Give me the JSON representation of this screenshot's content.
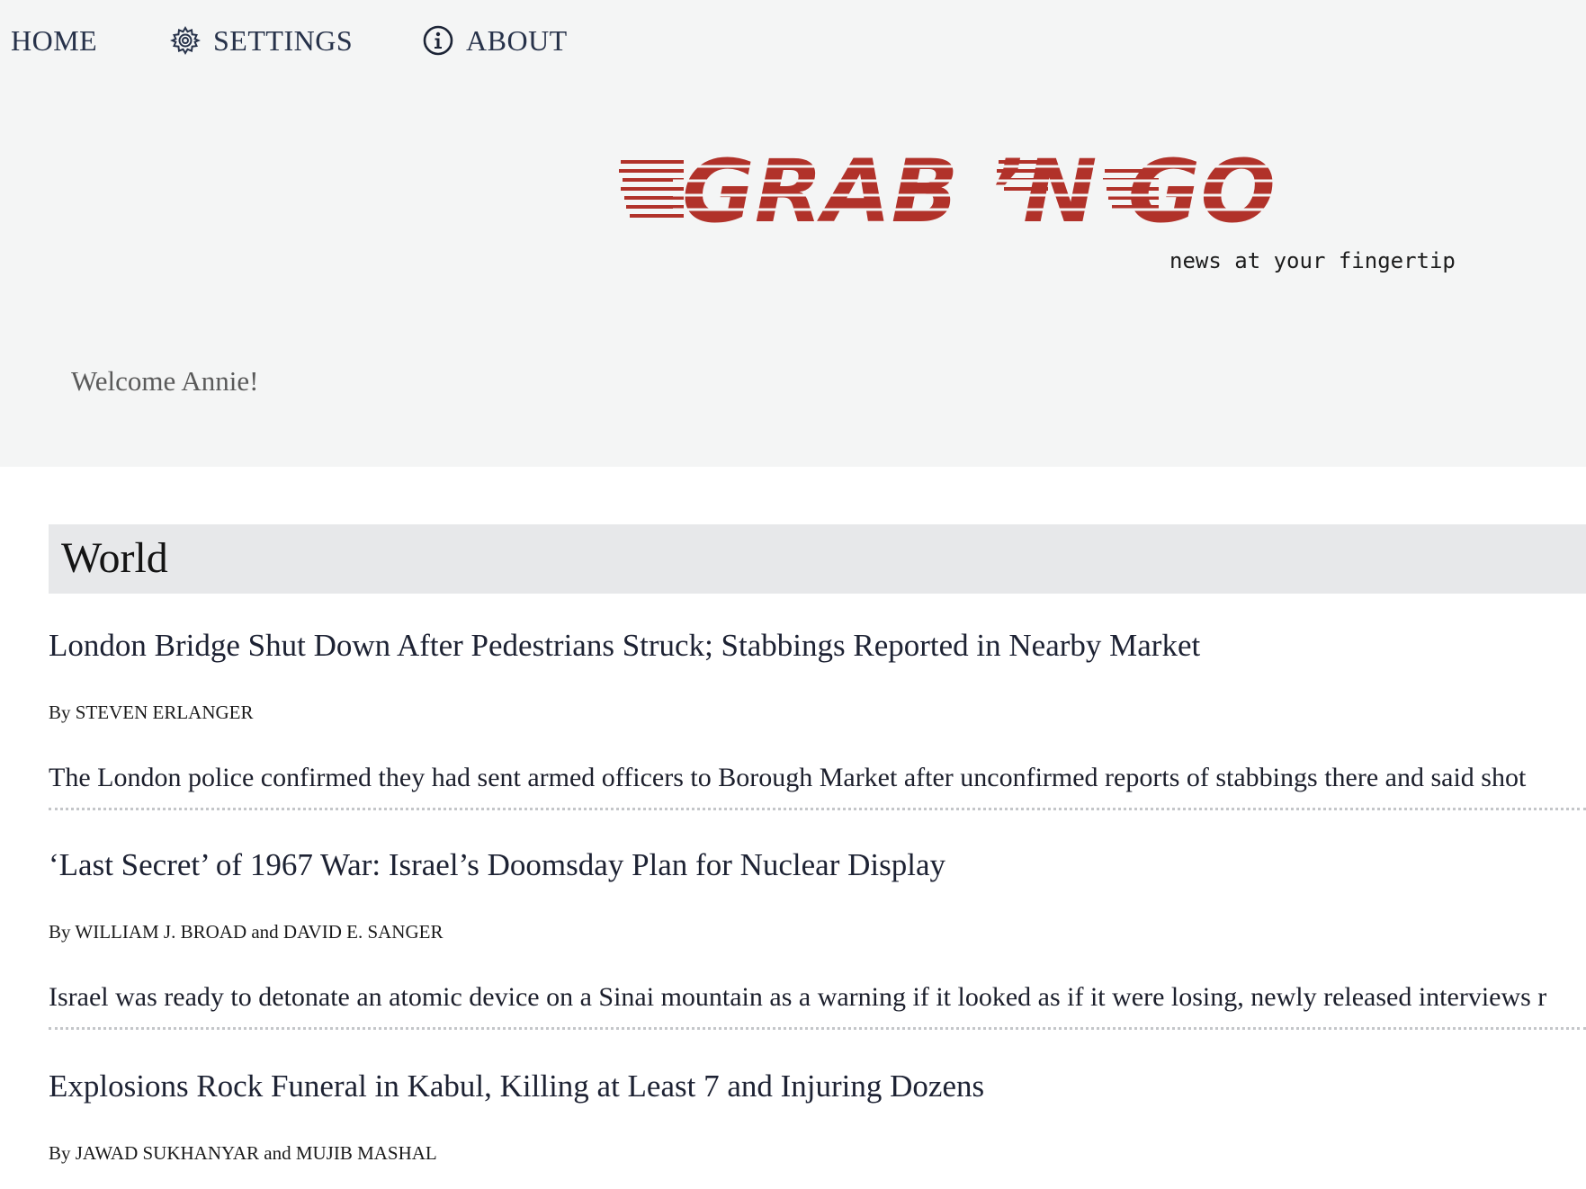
{
  "nav": {
    "home_label": "HOME",
    "settings_label": "SETTINGS",
    "about_label": "ABOUT"
  },
  "brand": {
    "logo_text": "GRAB 'N GO",
    "tagline": "news at your fingertip",
    "logo_color": "#b1322a"
  },
  "welcome": "Welcome Annie!",
  "section": {
    "title": "World"
  },
  "articles": [
    {
      "headline": "London Bridge Shut Down After Pedestrians Struck; Stabbings Reported in Nearby Market",
      "byline": "By STEVEN ERLANGER",
      "summary": "The London police confirmed they had sent armed officers to Borough Market after unconfirmed reports of stabbings there and said shot"
    },
    {
      "headline": "‘Last Secret’ of 1967 War: Israel’s Doomsday Plan for Nuclear Display",
      "byline": "By WILLIAM J. BROAD and DAVID E. SANGER",
      "summary": "Israel was ready to detonate an atomic device on a Sinai mountain as a warning if it looked as if it were losing, newly released interviews r"
    },
    {
      "headline": "Explosions Rock Funeral in Kabul, Killing at Least 7 and Injuring Dozens",
      "byline": "By JAWAD SUKHANYAR and MUJIB MASHAL"
    }
  ]
}
